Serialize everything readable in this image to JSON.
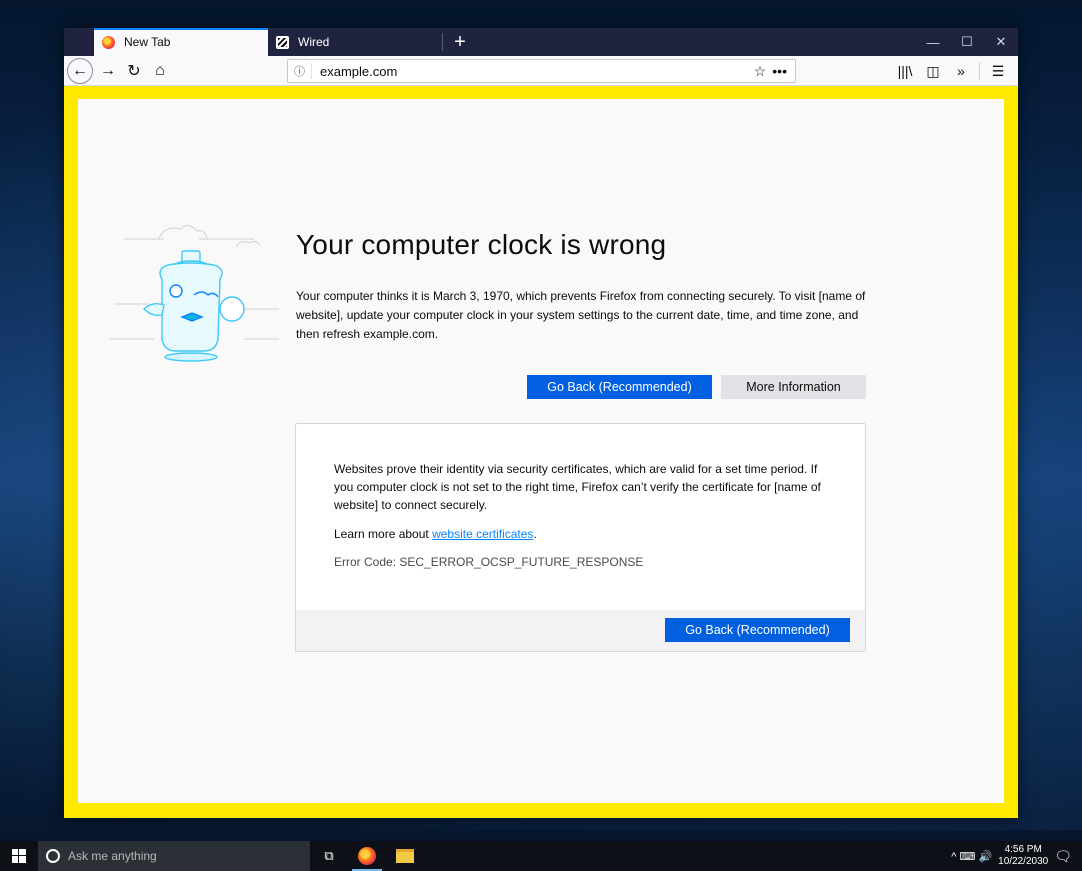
{
  "browser": {
    "tabs": [
      {
        "label": "New Tab",
        "icon": "firefox-icon"
      },
      {
        "label": "Wired",
        "icon": "wired-icon"
      }
    ],
    "new_tab": "+",
    "window_controls": {
      "minimize": "—",
      "maximize": "☐",
      "close": "✕"
    },
    "nav": {
      "back": "←",
      "forward": "→",
      "reload": "↻",
      "home": "⌂"
    },
    "url": "example.com",
    "url_info": "ⓘ",
    "url_star": "☆",
    "url_more": "•••",
    "toolbar": {
      "library": "|||\\",
      "sidebar": "◫",
      "overflow": "»",
      "menu": "☰"
    }
  },
  "page": {
    "title": "Your computer clock is wrong",
    "description": "Your computer thinks it is March 3, 1970, which prevents Firefox from connecting securely. To visit [name of website], update your computer clock in your system settings to the current date, time, and time zone, and then refresh example.com.",
    "go_back": "Go Back (Recommended)",
    "more_info": "More Information",
    "advanced": {
      "text": "Websites prove their identity via security certificates, which are valid for a set time period. If you computer clock is not set to the right time, Firefox can’t verify the certificate for [name of website] to connect securely.",
      "learn_prefix": "Learn more about ",
      "learn_link": "website certificates",
      "learn_suffix": ".",
      "error_code": "Error Code: SEC_ERROR_OCSP_FUTURE_RESPONSE",
      "go_back": "Go Back (Recommended)"
    }
  },
  "taskbar": {
    "search_placeholder": "Ask me anything",
    "time": "4:56 PM",
    "date": "10/22/2030",
    "tray_icons": "^ ⌨ 🔊"
  },
  "colors": {
    "accent": "#0060df",
    "frame": "#ffe900",
    "tabbar": "#202340"
  }
}
